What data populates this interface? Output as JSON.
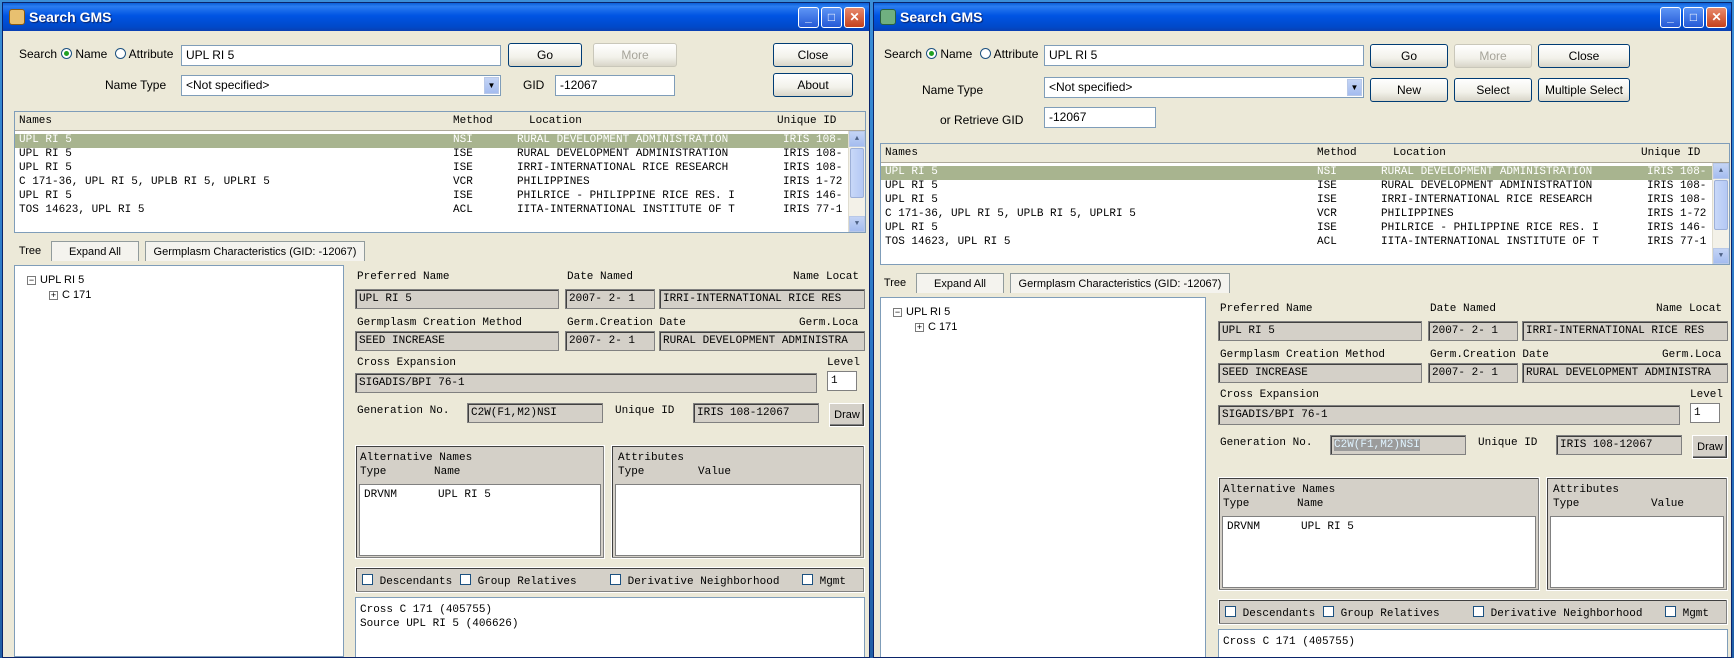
{
  "windows": [
    {
      "title": "Search GMS",
      "search_label": "Search",
      "radio_name": "Name",
      "radio_attribute": "Attribute",
      "search_value": "UPL RI 5",
      "go_label": "Go",
      "more_label": "More",
      "close_label": "Close",
      "about_label": "About",
      "name_type_label": "Name Type",
      "name_type_value": "<Not specified>",
      "gid_label": "GID",
      "gid_value": "-12067",
      "columns": [
        "Names",
        "Method",
        "Location",
        "Unique ID"
      ],
      "rows": [
        {
          "names": "UPL RI 5",
          "method": "NSI",
          "location": "RURAL DEVELOPMENT ADMINISTRATION",
          "uid": "IRIS 108-"
        },
        {
          "names": "UPL RI 5",
          "method": "ISE",
          "location": "RURAL DEVELOPMENT ADMINISTRATION",
          "uid": "IRIS 108-"
        },
        {
          "names": "UPL RI 5",
          "method": "ISE",
          "location": "IRRI-INTERNATIONAL RICE RESEARCH",
          "uid": "IRIS 108-"
        },
        {
          "names": "C 171-36, UPL RI 5, UPLB RI 5, UPLRI 5",
          "method": "VCR",
          "location": "PHILIPPINES",
          "uid": "IRIS 1-72"
        },
        {
          "names": "UPL RI 5",
          "method": "ISE",
          "location": "PHILRICE - PHILIPPINE RICE RES. I",
          "uid": "IRIS 146-"
        },
        {
          "names": "TOS 14623, UPL RI 5",
          "method": "ACL",
          "location": "IITA-INTERNATIONAL INSTITUTE OF T",
          "uid": "IRIS 77-1"
        }
      ],
      "tab_tree": "Tree",
      "tab_expand": "Expand All",
      "tab_germplasm": "Germplasm Characteristics (GID: -12067)",
      "tree": {
        "root": "UPL RI 5",
        "child": "C 171"
      },
      "details": {
        "preferred_name_label": "Preferred Name",
        "preferred_name": "UPL RI 5",
        "date_named_label": "Date Named",
        "date_named": "2007- 2- 1",
        "name_loc_label": "Name Locat",
        "name_loc": "IRRI-INTERNATIONAL RICE RES",
        "creation_method_label": "Germplasm Creation Method",
        "creation_method": "SEED INCREASE",
        "creation_date_label": "Germ.Creation Date",
        "creation_date": "2007- 2- 1",
        "germ_loc_label": "Germ.Loca",
        "germ_loc": "RURAL DEVELOPMENT ADMINISTRA",
        "cross_expansion_label": "Cross Expansion",
        "cross_expansion": "SIGADIS/BPI 76-1",
        "level_label": "Level",
        "level": "1",
        "generation_label": "Generation No.",
        "generation": "C2W(F1,M2)NSI",
        "unique_id_label": "Unique ID",
        "unique_id": "IRIS 108-12067",
        "draw_label": "Draw"
      },
      "alt_names": {
        "title": "Alternative Names",
        "col_type": "Type",
        "col_name": "Name",
        "type": "DRVNM",
        "name": "UPL RI 5"
      },
      "attributes": {
        "title": "Attributes",
        "col_type": "Type",
        "col_value": "Value"
      },
      "checks": {
        "descendants": "Descendants",
        "group_relatives": "Group Relatives",
        "derivative": "Derivative Neighborhood",
        "mgmt": "Mgmt"
      },
      "pedigree": [
        "Cross  C 171 (405755)",
        "Source UPL RI 5 (406626)"
      ]
    },
    {
      "title": "Search GMS",
      "search_label": "Search",
      "radio_name": "Name",
      "radio_attribute": "Attribute",
      "search_value": "UPL RI 5",
      "go_label": "Go",
      "more_label": "More",
      "close_label": "Close",
      "new_label": "New",
      "select_label": "Select",
      "multiple_select_label": "Multiple Select",
      "name_type_label": "Name Type",
      "name_type_value": "<Not specified>",
      "retrieve_label": "or Retrieve GID",
      "gid_value": "-12067",
      "columns": [
        "Names",
        "Method",
        "Location",
        "Unique ID"
      ],
      "rows": [
        {
          "names": "UPL RI 5",
          "method": "NSI",
          "location": "RURAL DEVELOPMENT ADMINISTRATION",
          "uid": "IRIS 108-"
        },
        {
          "names": "UPL RI 5",
          "method": "ISE",
          "location": "RURAL DEVELOPMENT ADMINISTRATION",
          "uid": "IRIS 108-"
        },
        {
          "names": "UPL RI 5",
          "method": "ISE",
          "location": "IRRI-INTERNATIONAL RICE RESEARCH",
          "uid": "IRIS 108-"
        },
        {
          "names": "C 171-36, UPL RI 5, UPLB RI 5, UPLRI 5",
          "method": "VCR",
          "location": "PHILIPPINES",
          "uid": "IRIS 1-72"
        },
        {
          "names": "UPL RI 5",
          "method": "ISE",
          "location": "PHILRICE - PHILIPPINE RICE RES. I",
          "uid": "IRIS 146-"
        },
        {
          "names": "TOS 14623, UPL RI 5",
          "method": "ACL",
          "location": "IITA-INTERNATIONAL INSTITUTE OF T",
          "uid": "IRIS 77-1"
        }
      ],
      "tab_tree": "Tree",
      "tab_expand": "Expand All",
      "tab_germplasm": "Germplasm Characteristics (GID: -12067)",
      "tree": {
        "root": "UPL RI 5",
        "child": "C 171"
      },
      "details": {
        "preferred_name_label": "Preferred Name",
        "preferred_name": "UPL RI 5",
        "date_named_label": "Date Named",
        "date_named": "2007- 2- 1",
        "name_loc_label": "Name Locat",
        "name_loc": "IRRI-INTERNATIONAL RICE RES",
        "creation_method_label": "Germplasm Creation Method",
        "creation_method": "SEED INCREASE",
        "creation_date_label": "Germ.Creation Date",
        "creation_date": "2007- 2- 1",
        "germ_loc_label": "Germ.Loca",
        "germ_loc": "RURAL DEVELOPMENT ADMINISTRA",
        "cross_expansion_label": "Cross Expansion",
        "cross_expansion": "SIGADIS/BPI 76-1",
        "level_label": "Level",
        "level": "1",
        "generation_label": "Generation No.",
        "generation": "C2W(F1,M2)NSI",
        "unique_id_label": "Unique ID",
        "unique_id": "IRIS 108-12067",
        "draw_label": "Draw"
      },
      "alt_names": {
        "title": "Alternative Names",
        "col_type": "Type",
        "col_name": "Name",
        "type": "DRVNM",
        "name": "UPL RI 5"
      },
      "attributes": {
        "title": "Attributes",
        "col_type": "Type",
        "col_value": "Value"
      },
      "checks": {
        "descendants": "Descendants",
        "group_relatives": "Group Relatives",
        "derivative": "Derivative Neighborhood",
        "mgmt": "Mgmt"
      },
      "pedigree": [
        "Cross  C 171 (405755)"
      ]
    }
  ]
}
